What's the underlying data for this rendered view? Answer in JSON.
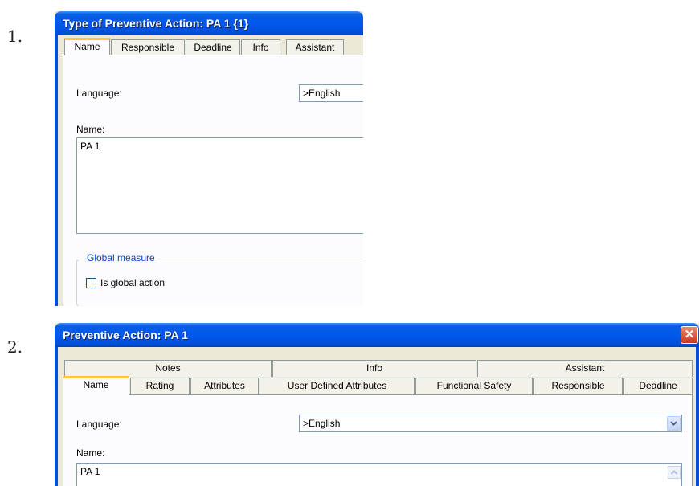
{
  "steps": [
    "1.",
    "2."
  ],
  "dialog1": {
    "title": "Type of Preventive Action: PA 1 {1}",
    "tabs": [
      "Name",
      "Responsible",
      "Deadline",
      "Info",
      "Assistant"
    ],
    "language_label": "Language:",
    "language_value": ">English",
    "name_label": "Name:",
    "name_value": "PA 1",
    "group_title": "Global measure",
    "checkbox_label": "Is global action",
    "checkbox_checked": false
  },
  "dialog2": {
    "title": "Preventive Action: PA 1",
    "close_glyph": "✕",
    "tabs_top": [
      "Notes",
      "Info",
      "Assistant"
    ],
    "tabs_bottom": [
      "Name",
      "Rating",
      "Attributes",
      "User Defined Attributes",
      "Functional Safety",
      "Responsible",
      "Deadline"
    ],
    "language_label": "Language:",
    "language_value": ">English",
    "name_label": "Name:",
    "name_value": "PA 1"
  },
  "icons": {
    "dropdown": "chevron-down-icon",
    "close": "close-icon",
    "scroll_up": "scroll-up-icon"
  },
  "colors": {
    "title_bar": "#0058ee",
    "dialog_bg": "#ece9d8",
    "group_title": "#0046d5",
    "active_tab_accent": "#ffc83c",
    "close_button": "#d34a2a"
  }
}
